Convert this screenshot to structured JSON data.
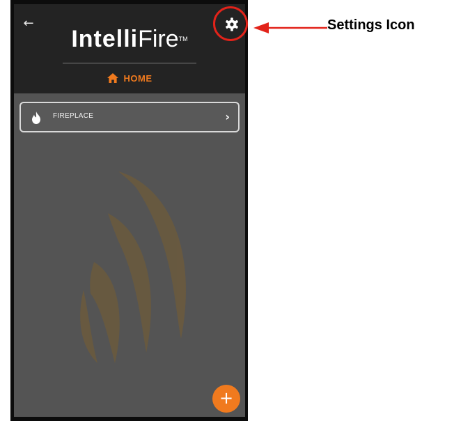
{
  "app": {
    "logo_bold": "Intelli",
    "logo_light": "Fire",
    "logo_tm": "TM",
    "nav_title": "HOME"
  },
  "device_list": [
    {
      "name": "FIREPLACE"
    }
  ],
  "fab": {
    "label": "+"
  },
  "annotation": {
    "callout_text": "Settings Icon"
  },
  "colors": {
    "accent": "#f07a1e",
    "header_bg": "#232323",
    "screen_bg": "#545454",
    "callout_red": "#e2231a"
  },
  "icons": [
    "back-arrow-icon",
    "gear-icon",
    "home-icon",
    "flame-icon",
    "chevron-right-icon",
    "plus-icon"
  ]
}
